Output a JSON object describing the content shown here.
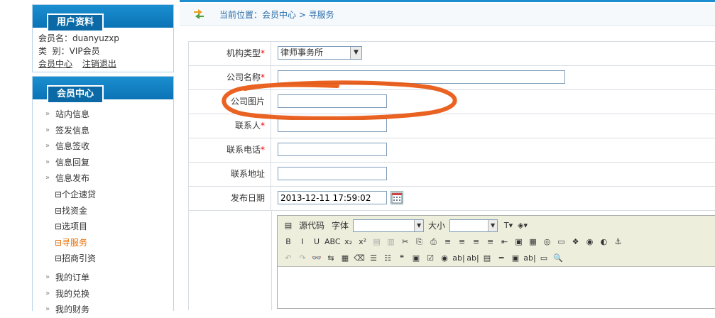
{
  "sidebar": {
    "profile": {
      "title": "用户资料",
      "username_line": "会员名：duanyuzxp",
      "type_line": "类  别：VIP会员",
      "link_center": "会员中心",
      "link_logout": "注销退出"
    },
    "member": {
      "title": "会员中心",
      "items": [
        {
          "label": "站内信息"
        },
        {
          "label": "签发信息"
        },
        {
          "label": "信息签收"
        },
        {
          "label": "信息回复"
        },
        {
          "label": "信息发布"
        },
        {
          "label": "⊟个企速贷"
        },
        {
          "label": "⊟找资金"
        },
        {
          "label": "⊟选项目"
        },
        {
          "label": "⊟寻服务"
        },
        {
          "label": "⊟招商引资"
        },
        {
          "label": "我的订单"
        },
        {
          "label": "我的兑换"
        },
        {
          "label": "我的财务"
        }
      ]
    }
  },
  "breadcrumb": {
    "text": "当前位置：会员中心 > 寻服务"
  },
  "form": {
    "org_type_label": "机构类型",
    "org_type_value": "律师事务所",
    "company_name_label": "公司名称",
    "company_name_value": "",
    "company_image_label": "公司图片",
    "contact_label": "联系人",
    "phone_label": "联系电话",
    "address_label": "联系地址",
    "date_label": "发布日期",
    "date_value": "2013-12-11 17:59:02"
  },
  "editor": {
    "source_label": "源代码",
    "font_label": "字体",
    "size_label": "大小",
    "row2": [
      "B",
      "I",
      "U",
      "ABC",
      "x₂",
      "x²",
      "▤",
      "▥",
      "✂",
      "⎘",
      "⎙",
      "≡",
      "≡",
      "≡",
      "≡",
      "⇤",
      "▣",
      "▦",
      "◎",
      "▭",
      "❖",
      "◉",
      "◐",
      "⚓"
    ],
    "row3": [
      "↶",
      "↷",
      "👓",
      "⇆",
      "▦",
      "⌫",
      "☰",
      "☷",
      "❝",
      "▣",
      "☑",
      "◉",
      "ab|",
      "ab|",
      "▤",
      "━",
      "▣",
      "ab|",
      "▭",
      "🔍"
    ]
  },
  "colors": {
    "accent": "#1b8fd0",
    "annotation": "#e8520a",
    "required": "#e00000",
    "active_menu": "#e86c00"
  }
}
